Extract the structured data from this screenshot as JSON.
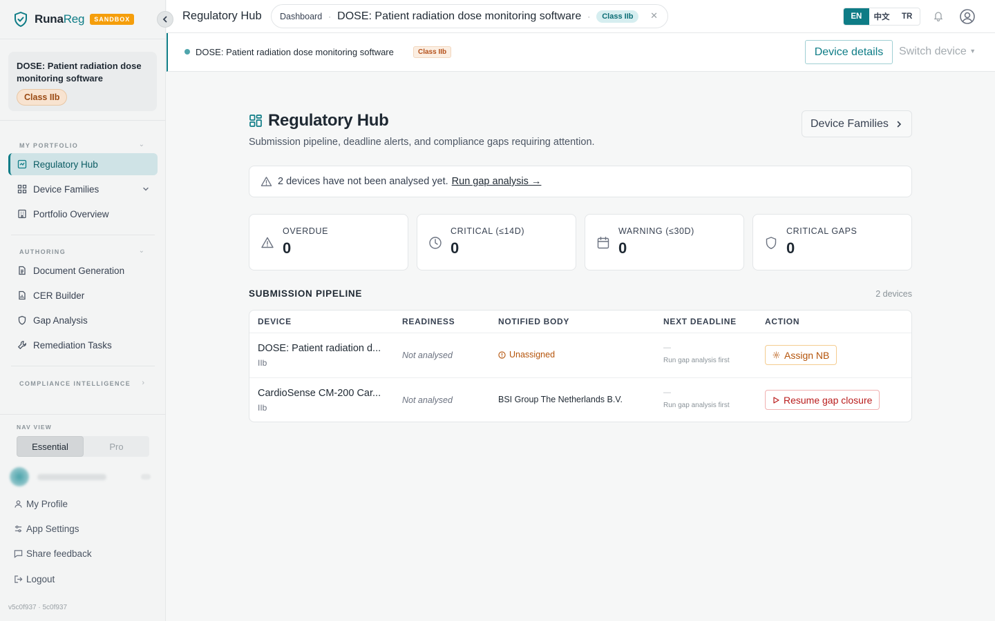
{
  "brand": {
    "name_bold": "Runa",
    "name_light": "Reg",
    "badge": "SANDBOX"
  },
  "sidebar": {
    "current_device": {
      "name": "DOSE: Patient radiation dose monitoring software",
      "class": "Class IIb"
    },
    "sections": {
      "portfolio": "MY PORTFOLIO",
      "authoring": "AUTHORING",
      "intelligence": "COMPLIANCE INTELLIGENCE"
    },
    "items": [
      {
        "label": "Regulatory Hub",
        "icon": "hub-icon",
        "active": true
      },
      {
        "label": "Device Families",
        "icon": "grid-icon"
      },
      {
        "label": "Portfolio Overview",
        "icon": "building-icon"
      },
      {
        "label": "Document Generation",
        "icon": "document-icon"
      },
      {
        "label": "CER Builder",
        "icon": "file-chart-icon"
      },
      {
        "label": "Gap Analysis",
        "icon": "shield-icon"
      },
      {
        "label": "Remediation Tasks",
        "icon": "wrench-icon"
      }
    ],
    "nav_view": {
      "label": "NAV VIEW",
      "options": [
        "Essential",
        "Pro"
      ],
      "selected": "Essential"
    },
    "footer": [
      {
        "label": "My Profile",
        "icon": "user-icon"
      },
      {
        "label": "App Settings",
        "icon": "sliders-icon"
      },
      {
        "label": "Share feedback",
        "icon": "message-icon"
      },
      {
        "label": "Logout",
        "icon": "logout-icon"
      }
    ],
    "version": "v5c0f937 · 5c0f937"
  },
  "topbar": {
    "page_title": "Regulatory Hub",
    "breadcrumb": {
      "root": "Dashboard",
      "separator": "·",
      "device": "DOSE: Patient radiation dose monitoring software",
      "class": "Class IIb"
    },
    "languages": [
      "EN",
      "中文",
      "TR"
    ],
    "selected_language": "EN"
  },
  "device_bar": {
    "device": "DOSE: Patient radiation dose monitoring software",
    "class": "Class IIb",
    "details_button": "Device details",
    "switch_label": "Switch device"
  },
  "main": {
    "title": "Regulatory Hub",
    "subtitle": "Submission pipeline, deadline alerts, and compliance gaps requiring attention.",
    "families_button": "Device Families",
    "alert": {
      "text": "2 devices have not been analysed yet.",
      "link": "Run gap analysis →"
    },
    "stats": [
      {
        "label": "OVERDUE",
        "value": "0",
        "icon": "warning-icon"
      },
      {
        "label": "CRITICAL (≤14D)",
        "value": "0",
        "icon": "clock-icon"
      },
      {
        "label": "WARNING (≤30D)",
        "value": "0",
        "icon": "calendar-icon"
      },
      {
        "label": "CRITICAL GAPS",
        "value": "0",
        "icon": "shield-icon"
      }
    ],
    "pipeline": {
      "title": "SUBMISSION PIPELINE",
      "count": "2 devices",
      "columns": [
        "DEVICE",
        "READINESS",
        "NOTIFIED BODY",
        "NEXT DEADLINE",
        "ACTION"
      ],
      "rows": [
        {
          "device": "DOSE: Patient radiation d...",
          "class": "IIb",
          "readiness": "Not analysed",
          "notified_body": "Unassigned",
          "deadline": "—",
          "deadline_note": "Run gap analysis first",
          "action": "Assign NB"
        },
        {
          "device": "CardioSense CM-200 Car...",
          "class": "IIb",
          "readiness": "Not analysed",
          "notified_body": "BSI Group The Netherlands B.V.",
          "deadline": "—",
          "deadline_note": "Run gap analysis first",
          "action": "Resume gap closure"
        }
      ]
    }
  },
  "colors": {
    "accent": "#0e7c86",
    "warning": "#b45309",
    "danger": "#b91c1c",
    "sandbox": "#f59e0b"
  }
}
